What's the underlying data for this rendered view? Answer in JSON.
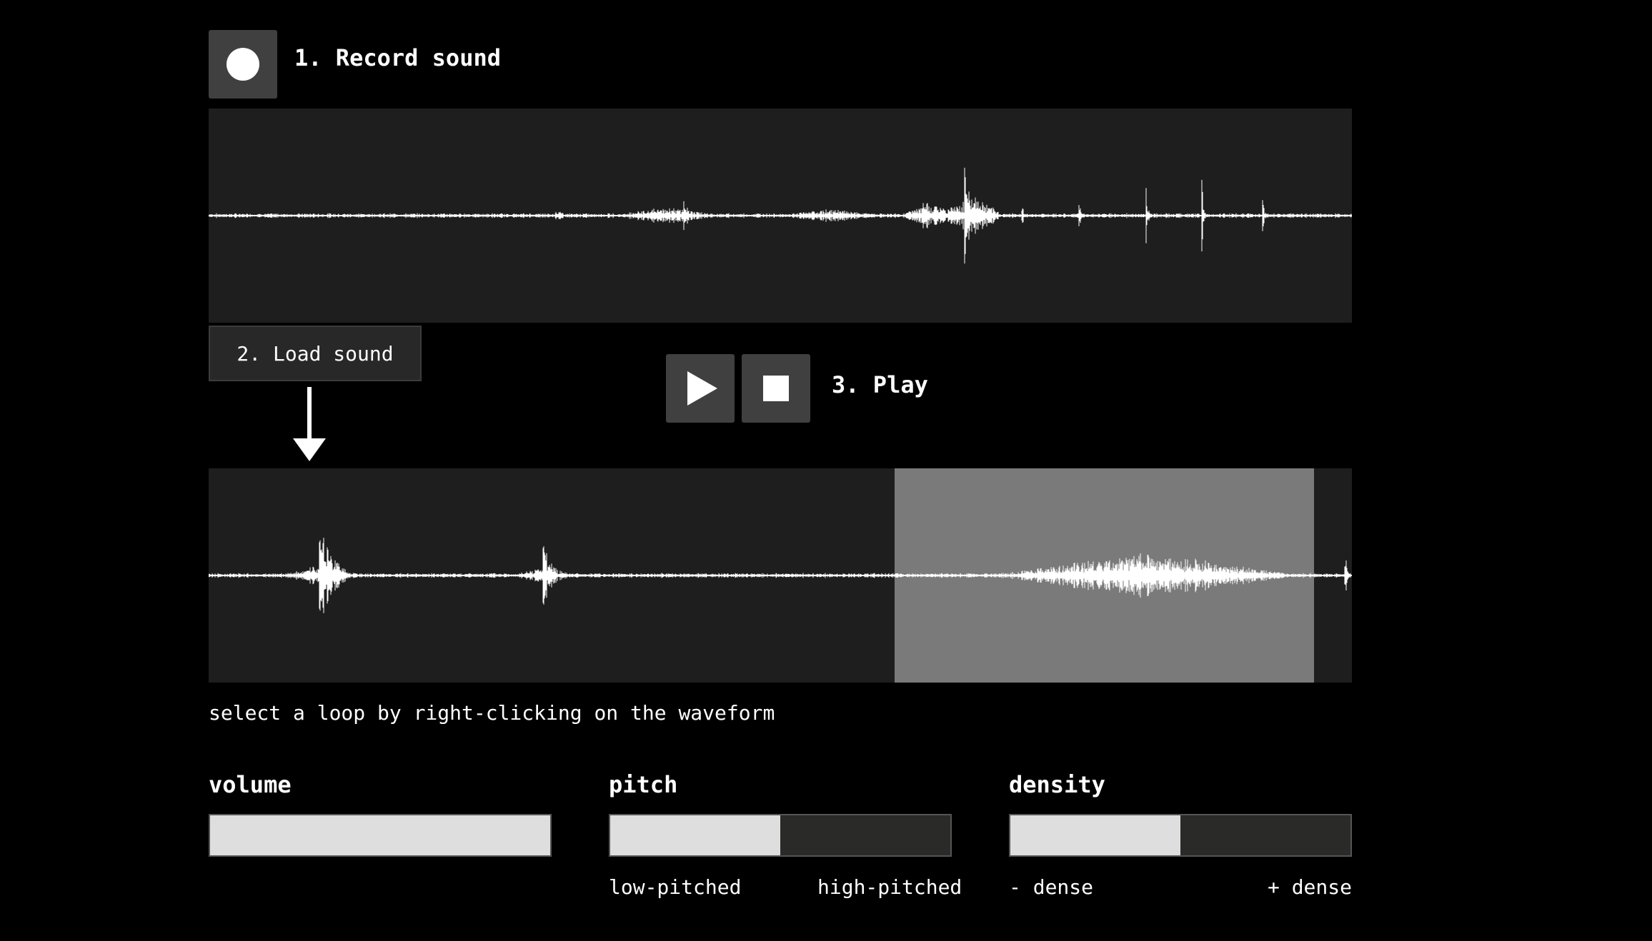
{
  "colors": {
    "background": "#000000",
    "panel": "#1e1e1e",
    "button": "#404040",
    "waveform": "#ffffff",
    "loop_selection": "#7a7a7a",
    "slider_fill": "#dedede",
    "slider_track": "#2a2a28"
  },
  "record": {
    "icon": "record-icon",
    "label": "1. Record sound"
  },
  "load": {
    "label": "2. Load sound",
    "arrow_icon": "arrow-down-icon"
  },
  "playback": {
    "play_icon": "play-icon",
    "stop_icon": "stop-icon",
    "label": "3. Play"
  },
  "hint": "select a loop by right-clicking on the waveform",
  "controls": {
    "volume": {
      "label": "volume",
      "value": 1.0
    },
    "pitch": {
      "label": "pitch",
      "value": 0.5,
      "min_label": "low-pitched",
      "max_label": "high-pitched"
    },
    "density": {
      "label": "density",
      "value": 0.5,
      "min_label": "- dense",
      "max_label": "+ dense"
    }
  },
  "loop_selection": {
    "start": 0.6,
    "end": 0.967
  }
}
